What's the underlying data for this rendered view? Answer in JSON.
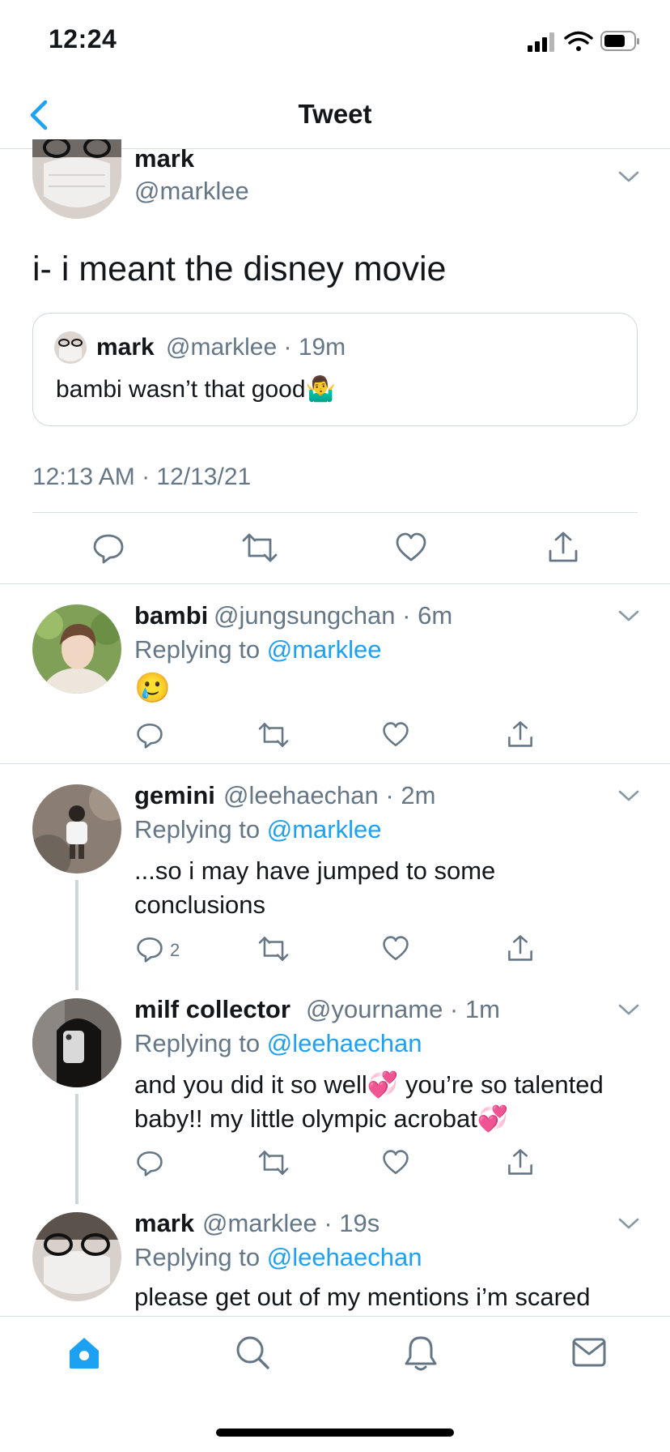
{
  "status_bar": {
    "time": "12:24"
  },
  "header": {
    "title": "Tweet"
  },
  "main_tweet": {
    "name": "mark",
    "handle": "@marklee",
    "text": "i- i meant the disney movie",
    "quoted": {
      "name": "mark",
      "handle_time": "@marklee · 19m",
      "text": "bambi wasn’t that good🤷‍♂️"
    },
    "timestamp": "12:13 AM · 12/13/21"
  },
  "replies": [
    {
      "name": "bambi",
      "handle_time": "@jungsungchan · 6m",
      "replying_prefix": "Replying to",
      "replying_to": "@marklee",
      "text": "🥲"
    },
    {
      "name": "gemini",
      "handle_time": "@leehaechan · 2m",
      "replying_prefix": "Replying to",
      "replying_to": "@marklee",
      "text_line1": "...so i may have jumped to some",
      "text_line2": "conclusions",
      "reply_count": "2"
    },
    {
      "name": "milf collector",
      "handle_time": "@yourname · 1m",
      "replying_prefix": "Replying to",
      "replying_to": "@leehaechan",
      "text_line1": "and you did it so well💞  you’re so talented",
      "text_line2": "baby!! my little olympic acrobat💞"
    },
    {
      "name": "mark",
      "handle_time": "@marklee · 19s",
      "replying_prefix": "Replying to",
      "replying_to": "@leehaechan",
      "text": "please get out of my mentions i’m scared"
    }
  ],
  "tab_bar": [
    "home-icon",
    "search-icon",
    "notifications-icon",
    "messages-icon"
  ],
  "colors": {
    "accent": "#1da1f2",
    "muted": "#657786",
    "divider": "#d9dee2"
  }
}
